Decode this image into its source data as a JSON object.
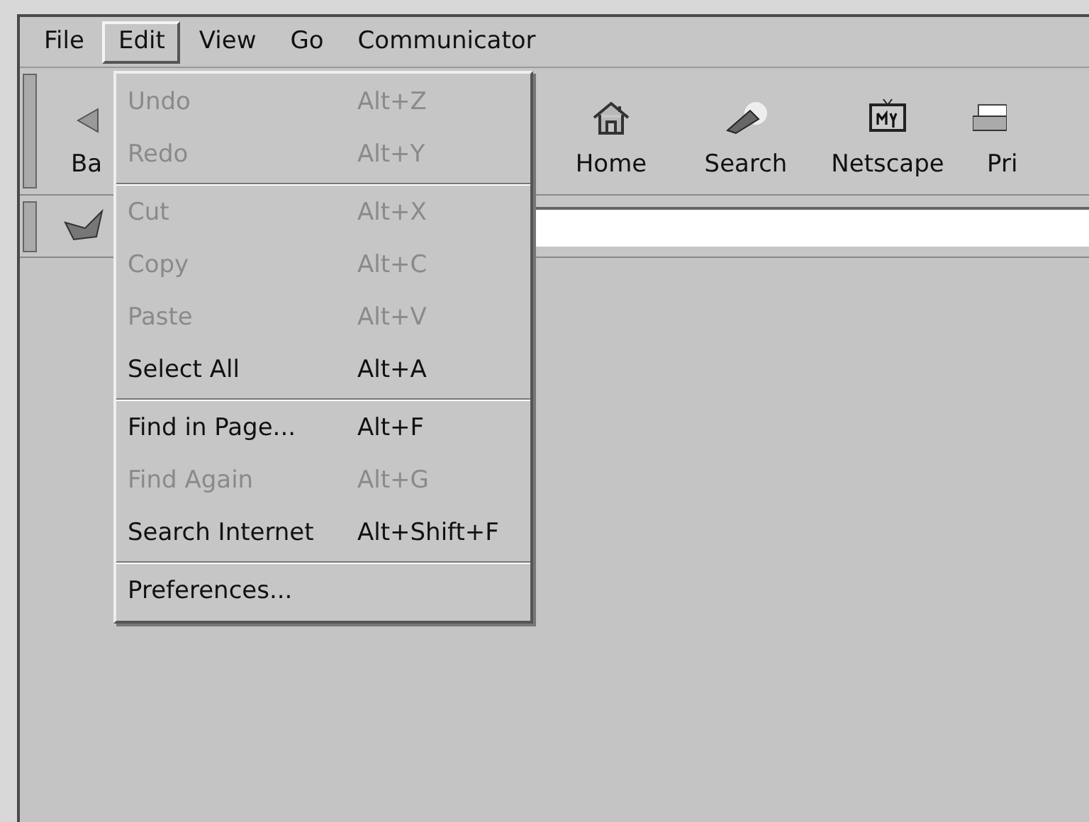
{
  "menu_bar": [
    {
      "label": "File",
      "selected": false
    },
    {
      "label": "Edit",
      "selected": true
    },
    {
      "label": "View",
      "selected": false
    },
    {
      "label": "Go",
      "selected": false
    },
    {
      "label": "Communicator",
      "selected": false
    }
  ],
  "toolbar": [
    {
      "label": "Ba",
      "kind": "back"
    },
    {
      "label": "Home",
      "kind": "home"
    },
    {
      "label": "Search",
      "kind": "search"
    },
    {
      "label": "Netscape",
      "kind": "my"
    },
    {
      "label": "Pri",
      "kind": "print"
    }
  ],
  "edit_menu": [
    {
      "kind": "item",
      "label": "Undo",
      "shortcut": "Alt+Z",
      "disabled": true
    },
    {
      "kind": "item",
      "label": "Redo",
      "shortcut": "Alt+Y",
      "disabled": true
    },
    {
      "kind": "separator"
    },
    {
      "kind": "item",
      "label": "Cut",
      "shortcut": "Alt+X",
      "disabled": true
    },
    {
      "kind": "item",
      "label": "Copy",
      "shortcut": "Alt+C",
      "disabled": true
    },
    {
      "kind": "item",
      "label": "Paste",
      "shortcut": "Alt+V",
      "disabled": true
    },
    {
      "kind": "item",
      "label": "Select All",
      "shortcut": "Alt+A",
      "disabled": false
    },
    {
      "kind": "separator"
    },
    {
      "kind": "item",
      "label": "Find in Page...",
      "shortcut": "Alt+F",
      "disabled": false
    },
    {
      "kind": "item",
      "label": "Find Again",
      "shortcut": "Alt+G",
      "disabled": true
    },
    {
      "kind": "item",
      "label": "Search Internet",
      "shortcut": "Alt+Shift+F",
      "disabled": false
    },
    {
      "kind": "separator"
    },
    {
      "kind": "item",
      "label": "Preferences...",
      "disabled": false
    }
  ]
}
